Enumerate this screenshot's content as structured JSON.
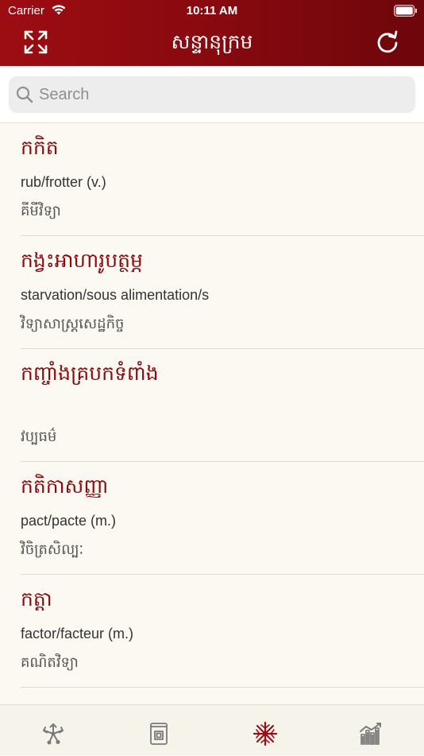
{
  "status_bar": {
    "carrier": "Carrier",
    "time": "10:11 AM"
  },
  "nav": {
    "title": "សន្ទានុក្រម",
    "left_icon": "expand-arrows-icon",
    "right_icon": "refresh-icon"
  },
  "search": {
    "placeholder": "Search",
    "value": ""
  },
  "entries": [
    {
      "head": "កកិត",
      "translation": "rub/frotter (v.)",
      "category": "គីមីវិទ្យា"
    },
    {
      "head": "កង្វះអាហារូបត្ថម្ភ",
      "translation": "starvation/sous alimentation/s",
      "category": "វិទ្យាសាស្ត្រសេដ្ឋកិច្ច"
    },
    {
      "head": "កញ្ចាំងគ្របកទំពាំង",
      "translation": "",
      "category": "វប្បធម៌"
    },
    {
      "head": "កតិកាសញ្ញា",
      "translation": "pact/pacte (m.)",
      "category": "វិចិត្រសិល្បៈ"
    },
    {
      "head": "កត្តា",
      "translation": "factor/facteur (m.)",
      "category": "គណិតវិទ្យា"
    }
  ],
  "tabs": [
    {
      "icon": "network-arrows-icon",
      "active": false
    },
    {
      "icon": "book-icon",
      "active": false
    },
    {
      "icon": "starburst-icon",
      "active": true
    },
    {
      "icon": "chart-trend-icon",
      "active": false
    }
  ],
  "colors": {
    "brand": "#8b0a10",
    "tab_active": "#9a0f1a",
    "tab_inactive": "#7a7a7a",
    "background": "#fbf9f1"
  }
}
